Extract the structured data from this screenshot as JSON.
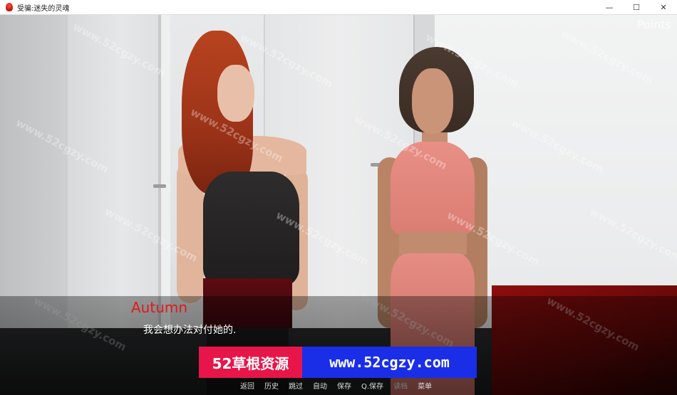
{
  "window": {
    "title": "受骗:迷失的灵魂",
    "minimize": "—",
    "maximize": "☐",
    "close": "✕"
  },
  "hud": {
    "points_label": "Points"
  },
  "dialogue": {
    "speaker": "Autumn",
    "speaker_color": "#e01a1a",
    "text": "我会想办法对付她的."
  },
  "banner": {
    "left_text": "52草根资源",
    "right_text": "www.52cgzy.com",
    "left_color": "#e8154a",
    "right_color": "#1a2ee8"
  },
  "watermark": "www.52cgzy.com",
  "quick_menu": [
    {
      "label": "返回",
      "enabled": true
    },
    {
      "label": "历史",
      "enabled": true
    },
    {
      "label": "跳过",
      "enabled": true
    },
    {
      "label": "自动",
      "enabled": true
    },
    {
      "label": "保存",
      "enabled": true
    },
    {
      "label": "Q.保存",
      "enabled": true
    },
    {
      "label": "读档",
      "enabled": false
    },
    {
      "label": "菜单",
      "enabled": true
    }
  ]
}
